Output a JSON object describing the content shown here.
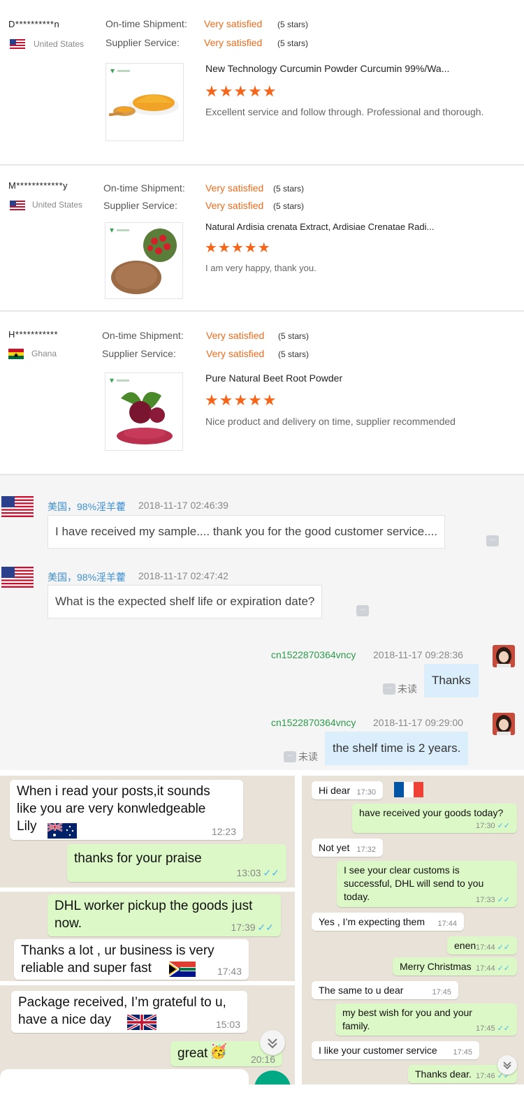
{
  "reviews": [
    {
      "buyer": "D**********n",
      "country": "United States",
      "shipment_label": "On-time Shipment:",
      "shipment_value": "Very satisfied",
      "shipment_stars": "(5 stars)",
      "service_label": "Supplier Service:",
      "service_value": "Very satisfied",
      "service_stars": "(5 stars)",
      "product": "New Technology Curcumin Powder Curcumin 99%/Wa...",
      "rating_stars": "★★★★★",
      "comment": "Excellent service and follow through.  Professional and thorough."
    },
    {
      "buyer": "M************y",
      "country": "United States",
      "shipment_label": "On-time Shipment:",
      "shipment_value": "Very satisfied",
      "shipment_stars": "(5 stars)",
      "service_label": "Supplier Service:",
      "service_value": "Very satisfied",
      "service_stars": "(5 stars)",
      "product": "Natural Ardisia crenata Extract, Ardisiae Crenatae Radi...",
      "rating_stars": "★★★★★",
      "comment": "I am very happy, thank you."
    },
    {
      "buyer": "H***********",
      "country": "Ghana",
      "shipment_label": "On-time Shipment:",
      "shipment_value": "Very satisfied",
      "shipment_stars": "(5 stars)",
      "service_label": "Supplier Service:",
      "service_value": "Very satisfied",
      "service_stars": "(5 stars)",
      "product": "Pure Natural Beet Root Powder",
      "rating_stars": "★★★★★",
      "comment": "Nice product and delivery on time, supplier recommended"
    }
  ],
  "chat": {
    "messages": [
      {
        "sender": "美国，98%淫羊藿",
        "time": "2018-11-17 02:46:39",
        "text": "I have received my sample.... thank you for the good customer service....",
        "more": "..."
      },
      {
        "sender": "美国，98%淫羊藿",
        "time": "2018-11-17 02:47:42",
        "text": "What is the expected shelf life or expiration date?",
        "more": "..."
      },
      {
        "sender": "cn1522870364vncy",
        "time": "2018-11-17 09:28:36",
        "text": "Thanks",
        "status": "未读",
        "more": "..."
      },
      {
        "sender": "cn1522870364vncy",
        "time": "2018-11-17 09:29:00",
        "text": "the shelf time is 2 years.",
        "status": "未读",
        "more": "..."
      }
    ]
  },
  "whatsapp_left": [
    {
      "dir": "in",
      "text": "When i read your posts,it sounds\nlike you are very konwledgeable\nLily",
      "time": "12:23"
    },
    {
      "dir": "out",
      "text": "thanks for your praise",
      "time": "13:03"
    },
    {
      "dir": "out",
      "text": "DHL worker pickup the goods just\nnow.",
      "time": "17:39"
    },
    {
      "dir": "in",
      "text": "Thanks a lot , ur business is very\nreliable and super fast",
      "time": "17:43"
    },
    {
      "dir": "in",
      "text": "Package received, I’m grateful to u,\nhave a nice day",
      "time": "15:03"
    },
    {
      "dir": "out",
      "text": "great",
      "time": "20:16"
    }
  ],
  "whatsapp_right": [
    {
      "dir": "in",
      "text": "Hi dear",
      "time": "17:30"
    },
    {
      "dir": "out",
      "text": "have received your goods today?",
      "time": "17:30"
    },
    {
      "dir": "in",
      "text": "Not yet",
      "time": "17:32"
    },
    {
      "dir": "out",
      "text": "I see your clear customs is\nsuccessful, DHL will send to you\ntoday.",
      "time": "17:33"
    },
    {
      "dir": "in",
      "text": "Yes , I’m expecting them",
      "time": "17:44"
    },
    {
      "dir": "out",
      "text": "enen",
      "time": "17:44"
    },
    {
      "dir": "out",
      "text": "Merry Christmas",
      "time": "17:44"
    },
    {
      "dir": "in",
      "text": "The same to u dear",
      "time": "17:45"
    },
    {
      "dir": "out",
      "text": "my best wish for you and your\nfamily.",
      "time": "17:45"
    },
    {
      "dir": "in",
      "text": "I like your customer service",
      "time": "17:45"
    },
    {
      "dir": "out",
      "text": "Thanks dear.",
      "time": "17:46"
    }
  ],
  "colors": {
    "satisfied": "#f06a1a",
    "star": "#f5661a",
    "buyer_link": "#3d8fd1",
    "seller_link": "#2b9b4b",
    "wa_out": "#dcf8c6",
    "wa_in": "#ffffff",
    "wa_bg": "#e8e2d8",
    "ticks": "#4fb6ec"
  },
  "icons": [
    "us-flag-icon",
    "ghana-flag-icon",
    "australia-flag-icon",
    "south-africa-flag-icon",
    "uk-flag-icon",
    "france-flag-icon",
    "party-emoji-icon",
    "scroll-down-icon",
    "more-icon",
    "avatar"
  ]
}
